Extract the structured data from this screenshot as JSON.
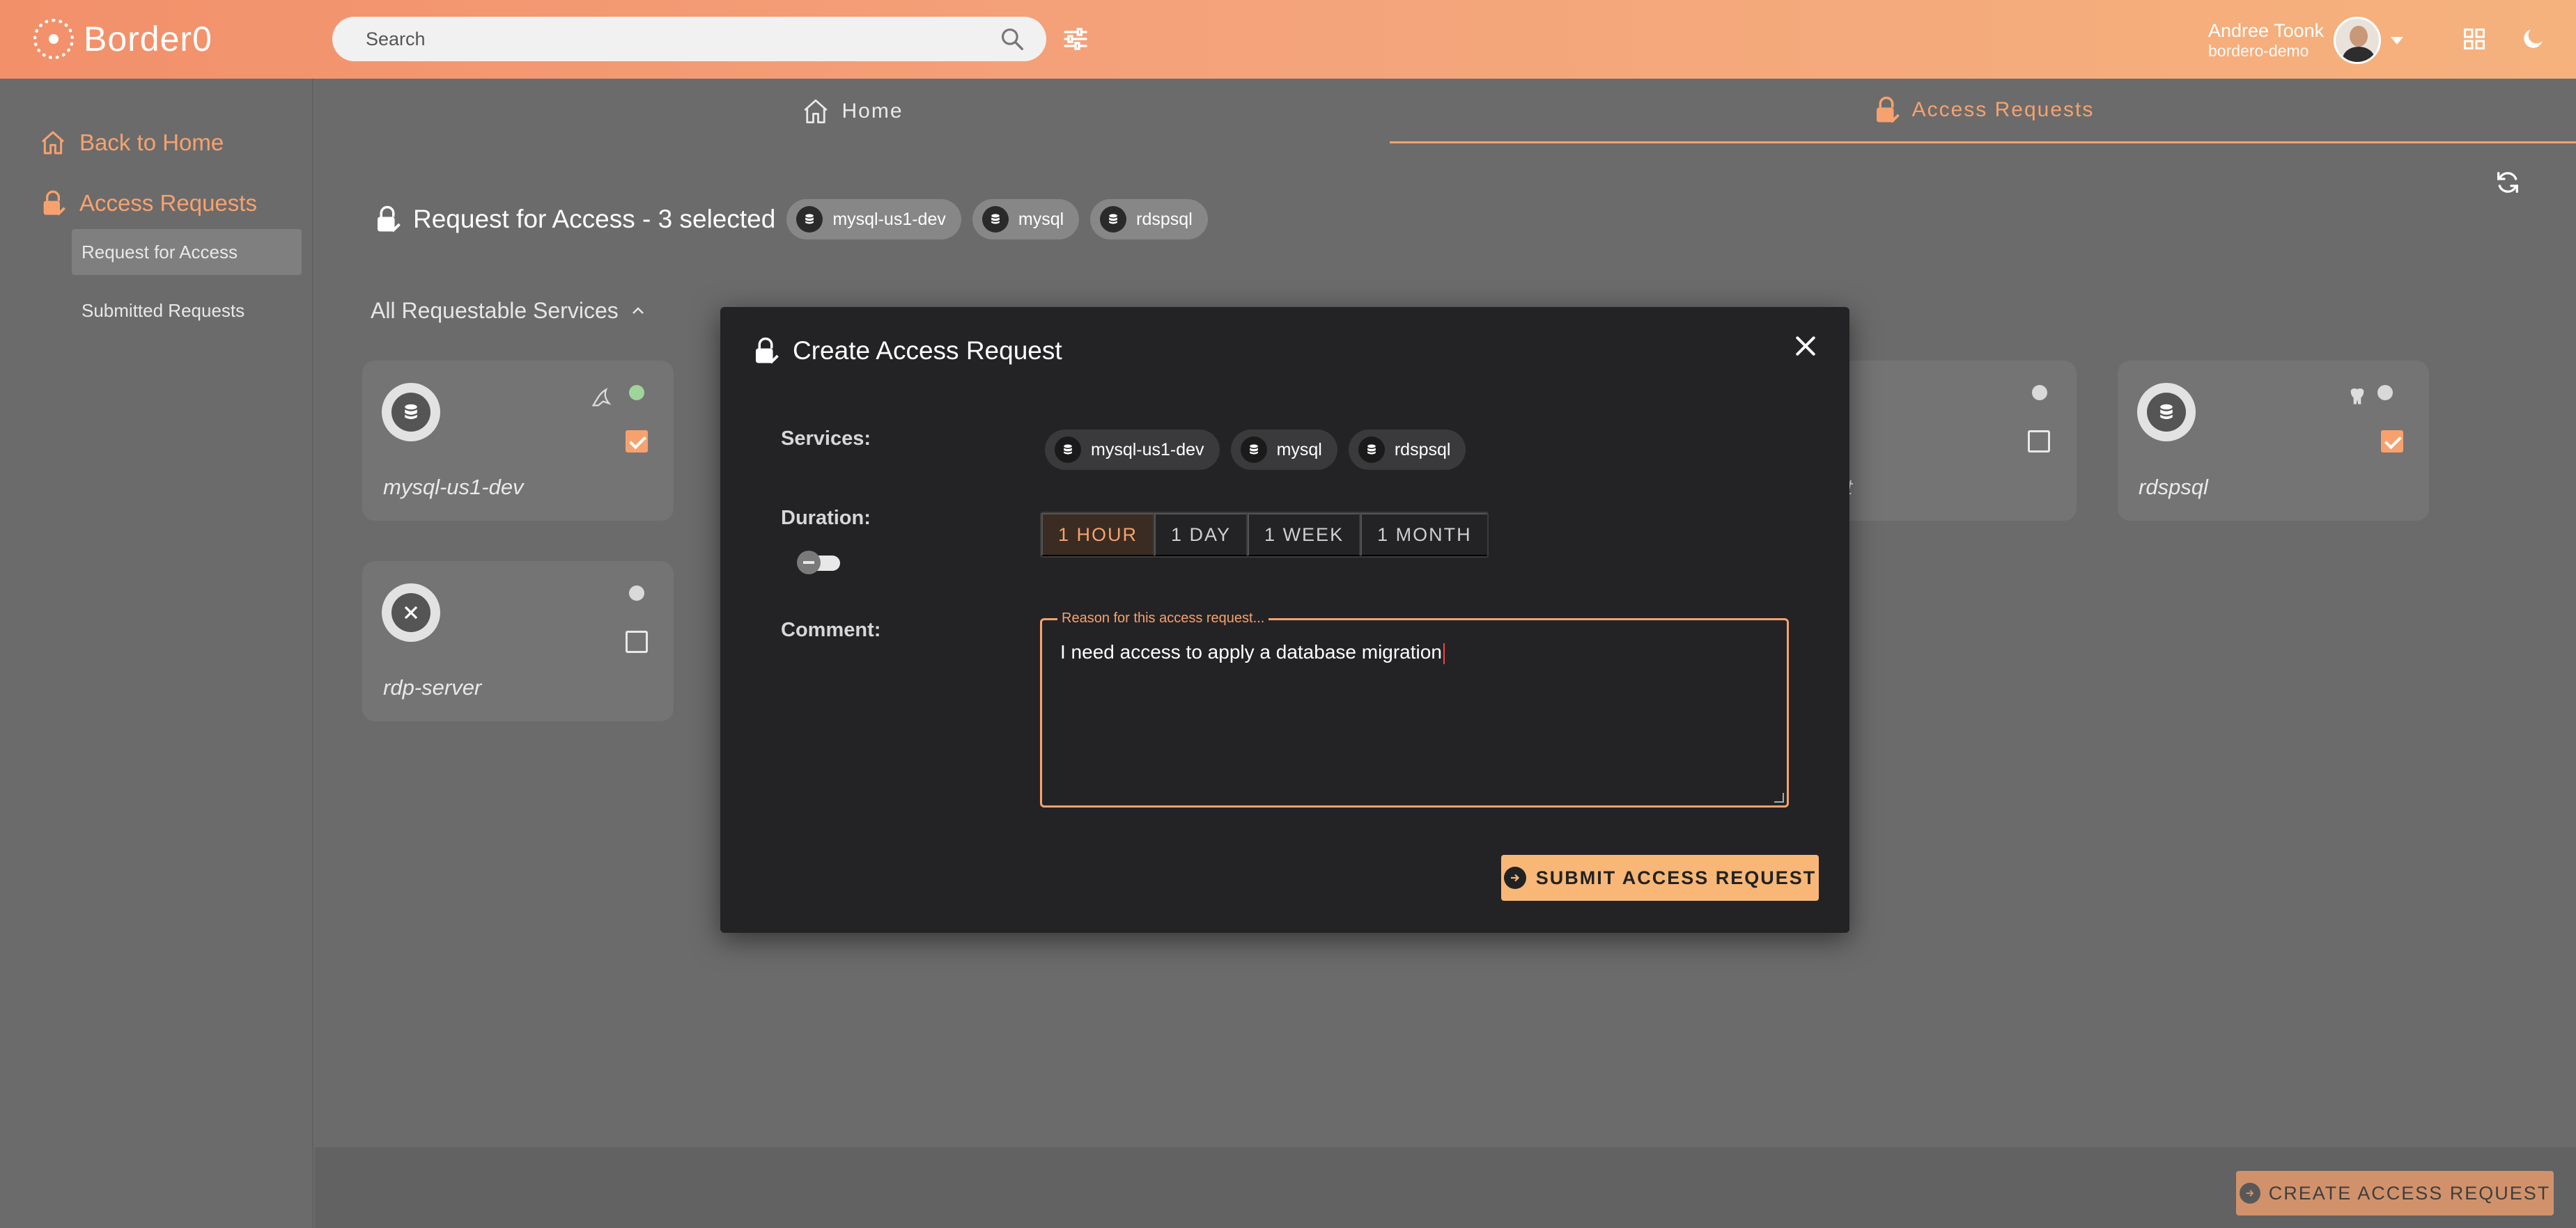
{
  "brand": {
    "name": "Border0",
    "accent": "#f7a26e"
  },
  "search": {
    "placeholder": "Search"
  },
  "user": {
    "name": "Andree Toonk",
    "org": "bordero-demo"
  },
  "sidebar": {
    "back_label": "Back to Home",
    "section_label": "Access Requests",
    "items": [
      {
        "label": "Request for Access",
        "active": true
      },
      {
        "label": "Submitted Requests",
        "active": false
      }
    ]
  },
  "tabs": [
    {
      "label": "Home",
      "icon": "home-icon",
      "active": false
    },
    {
      "label": "Access Requests",
      "icon": "lock-check-icon",
      "active": true
    }
  ],
  "request": {
    "title": "Request for Access - 3 selected",
    "selected": [
      "mysql-us1-dev",
      "mysql",
      "rdspsql"
    ]
  },
  "services_section": {
    "label": "All Requestable Services"
  },
  "cards": [
    {
      "name": "mysql-us1-dev",
      "status_color": "#9fd49a",
      "checked": true
    },
    {
      "name": "rdspsql",
      "status_color": "#d9d9d9",
      "checked": true
    },
    {
      "name": "rdp-server",
      "status_color": "#d9d9d9",
      "checked": false
    },
    {
      "name_partial": "st",
      "status_color": "#d9d9d9",
      "checked": false
    }
  ],
  "modal": {
    "title": "Create Access Request",
    "services_label": "Services:",
    "services": [
      "mysql-us1-dev",
      "mysql",
      "rdspsql"
    ],
    "duration_label": "Duration:",
    "durations": [
      "1 HOUR",
      "1 DAY",
      "1 WEEK",
      "1 MONTH"
    ],
    "selected_duration": "1 HOUR",
    "comment_label": "Comment:",
    "comment_legend": "Reason for this access request...",
    "comment_value": "I need access to apply a database migration",
    "submit_label": "SUBMIT ACCESS REQUEST"
  },
  "footer": {
    "create_label": "CREATE ACCESS REQUEST"
  }
}
